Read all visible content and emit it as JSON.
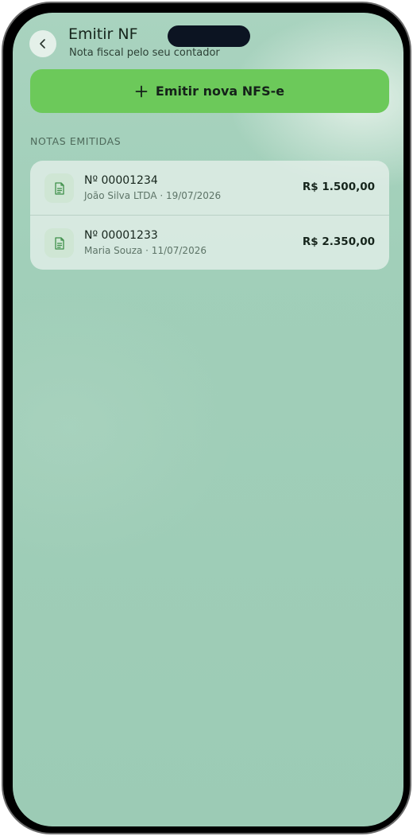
{
  "header": {
    "title": "Emitir NF",
    "subtitle": "Nota fiscal pelo seu contador",
    "back_icon": "chevron-left-icon"
  },
  "actions": {
    "emit_label": "Emitir nova NFS-e",
    "emit_icon": "plus-icon"
  },
  "section": {
    "label": "NOTAS EMITIDAS"
  },
  "invoices": [
    {
      "number": "Nº 00001234",
      "client_date": "João Silva LTDA · 19/07/2026",
      "amount": "R$ 1.500,00",
      "icon": "document-icon"
    },
    {
      "number": "Nº 00001233",
      "client_date": "Maria Souza · 11/07/2026",
      "amount": "R$ 2.350,00",
      "icon": "document-icon"
    }
  ],
  "colors": {
    "accent": "#6cc95a",
    "background": "#9ccbb5",
    "icon_green": "#3f8f4a"
  }
}
